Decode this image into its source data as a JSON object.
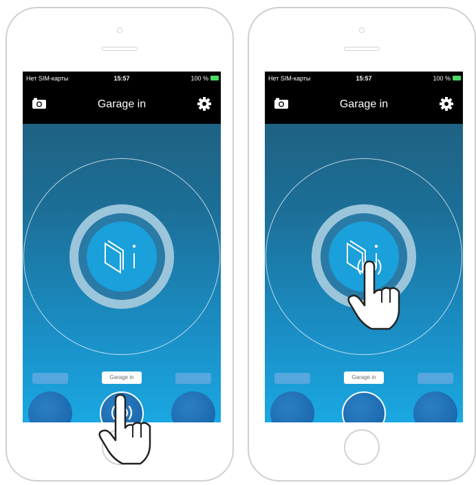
{
  "status_bar": {
    "carrier": "Нет SIM-карты",
    "time": "15:57",
    "battery": "100 %"
  },
  "navbar": {
    "title": "Garage in",
    "left_icon": "camera-icon",
    "right_icon": "gear-icon"
  },
  "main": {
    "center_button_icon": "garage-door-icon"
  },
  "favorites": {
    "center_label": "Garage in"
  },
  "colors": {
    "screen_top": "#205a76",
    "screen_bottom": "#1aa8e2",
    "core": "#1aa0da"
  }
}
